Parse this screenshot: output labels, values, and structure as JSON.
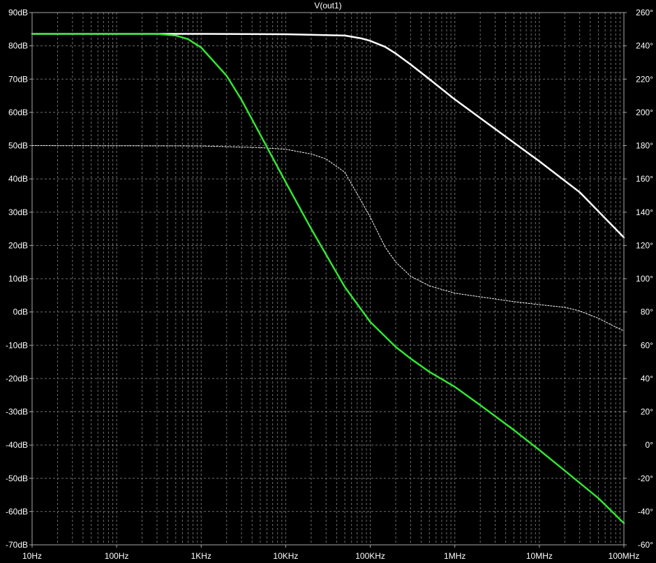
{
  "chart_data": {
    "type": "line",
    "title": "V(out1)",
    "x_scale": "log",
    "xlim": [
      10,
      100000000
    ],
    "ylim_left": [
      -70,
      90
    ],
    "ylim_right": [
      -60,
      260
    ],
    "grid": true,
    "x_ticks": [
      {
        "value": 10,
        "label": "10Hz"
      },
      {
        "value": 100,
        "label": "100Hz"
      },
      {
        "value": 1000,
        "label": "1KHz"
      },
      {
        "value": 10000,
        "label": "10KHz"
      },
      {
        "value": 100000,
        "label": "100KHz"
      },
      {
        "value": 1000000,
        "label": "1MHz"
      },
      {
        "value": 10000000,
        "label": "10MHz"
      },
      {
        "value": 100000000,
        "label": "100MHz"
      }
    ],
    "y_left_ticks": [
      {
        "value": 90,
        "label": "90dB"
      },
      {
        "value": 80,
        "label": "80dB"
      },
      {
        "value": 70,
        "label": "70dB"
      },
      {
        "value": 60,
        "label": "60dB"
      },
      {
        "value": 50,
        "label": "50dB"
      },
      {
        "value": 40,
        "label": "40dB"
      },
      {
        "value": 30,
        "label": "30dB"
      },
      {
        "value": 20,
        "label": "20dB"
      },
      {
        "value": 10,
        "label": "10dB"
      },
      {
        "value": 0,
        "label": "0dB"
      },
      {
        "value": -10,
        "label": "-10dB"
      },
      {
        "value": -20,
        "label": "-20dB"
      },
      {
        "value": -30,
        "label": "-30dB"
      },
      {
        "value": -40,
        "label": "-40dB"
      },
      {
        "value": -50,
        "label": "-50dB"
      },
      {
        "value": -60,
        "label": "-60dB"
      },
      {
        "value": -70,
        "label": "-70dB"
      }
    ],
    "y_right_ticks": [
      {
        "value": 260,
        "label": "260°"
      },
      {
        "value": 240,
        "label": "240°"
      },
      {
        "value": 220,
        "label": "220°"
      },
      {
        "value": 200,
        "label": "200°"
      },
      {
        "value": 180,
        "label": "180°"
      },
      {
        "value": 160,
        "label": "160°"
      },
      {
        "value": 140,
        "label": "140°"
      },
      {
        "value": 120,
        "label": "120°"
      },
      {
        "value": 100,
        "label": "100°"
      },
      {
        "value": 80,
        "label": "80°"
      },
      {
        "value": 60,
        "label": "60°"
      },
      {
        "value": 40,
        "label": "40°"
      },
      {
        "value": 20,
        "label": "20°"
      },
      {
        "value": 0,
        "label": "0°"
      },
      {
        "value": -20,
        "label": "-20°"
      },
      {
        "value": -40,
        "label": "-40°"
      },
      {
        "value": -60,
        "label": "-60°"
      }
    ],
    "series": [
      {
        "color": "#ffffff",
        "axis": "left",
        "style": "solid",
        "x": [
          10,
          1000,
          10000,
          50000,
          80000,
          100000,
          150000,
          200000,
          300000,
          500000,
          1000000,
          2000000,
          5000000,
          10000000,
          30000000,
          100000000
        ],
        "y": [
          83.6,
          83.6,
          83.5,
          83.1,
          82.2,
          81.5,
          79.7,
          77.7,
          74.4,
          70.0,
          63.9,
          58.3,
          50.9,
          45.3,
          36.0,
          22.4
        ]
      },
      {
        "color": "#ffffff",
        "axis": "right",
        "style": "dashed",
        "x": [
          10,
          1000,
          5000,
          10000,
          20000,
          30000,
          50000,
          70000,
          100000,
          150000,
          200000,
          300000,
          500000,
          1000000,
          2000000,
          5000000,
          10000000,
          20000000,
          30000000,
          50000000,
          70000000,
          100000000
        ],
        "y": [
          180,
          179.8,
          178.8,
          177.8,
          175,
          172,
          164,
          151,
          137,
          119,
          110,
          101.5,
          95.7,
          91.3,
          89.1,
          86.2,
          84.4,
          82.8,
          80.6,
          76.2,
          72.4,
          68.6
        ]
      },
      {
        "color": "#32e632",
        "axis": "left",
        "style": "solid",
        "x": [
          10,
          300,
          500,
          700,
          1000,
          2000,
          3000,
          5000,
          10000,
          20000,
          50000,
          100000,
          200000,
          300000,
          500000,
          1000000,
          2000000,
          5000000,
          10000000,
          20000000,
          50000000,
          100000000
        ],
        "y": [
          83.6,
          83.6,
          83.1,
          82,
          79.5,
          71,
          63.8,
          53.3,
          39,
          25,
          7.5,
          -3,
          -10.5,
          -14,
          -18,
          -22.5,
          -28,
          -35.5,
          -41.5,
          -47.7,
          -56,
          -63.5
        ]
      }
    ]
  }
}
